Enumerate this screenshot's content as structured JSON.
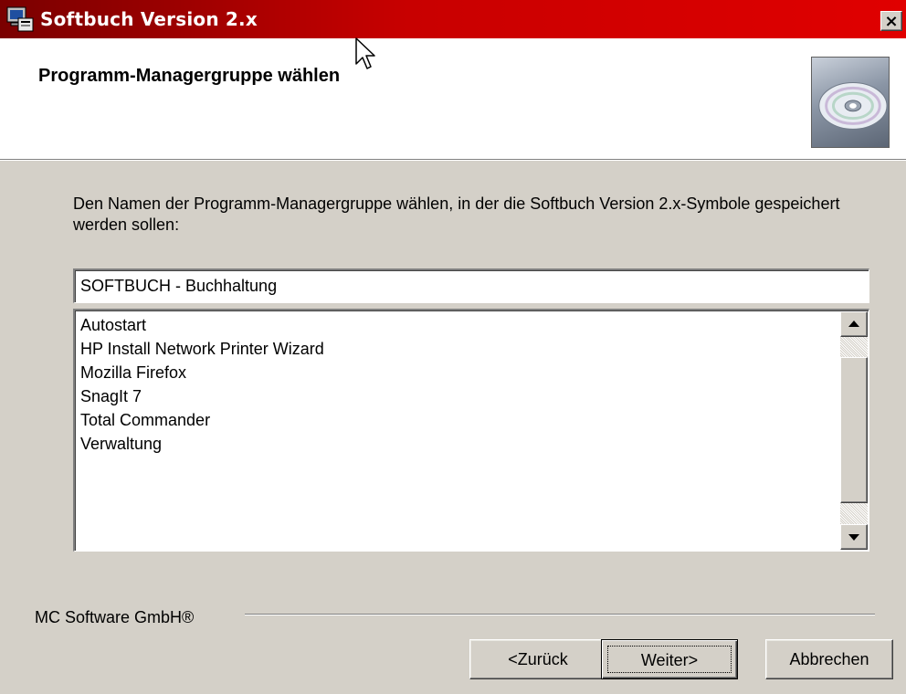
{
  "window": {
    "title": "Softbuch Version 2.x",
    "close_label": "×"
  },
  "header": {
    "title": "Programm-Managergruppe wählen",
    "image_icon": "cd-disc-icon"
  },
  "main": {
    "description": "Den Namen der Programm-Managergruppe wählen, in der die Softbuch Version 2.x-Symbole gespeichert werden sollen:",
    "group_value": "SOFTBUCH - Buchhaltung",
    "list_items": [
      "Autostart",
      "HP Install Network Printer Wizard",
      "Mozilla Firefox",
      "SnagIt 7",
      "Total Commander",
      "Verwaltung"
    ]
  },
  "footer": {
    "brand": "MC Software GmbH®",
    "back_label": "<Zurück",
    "next_label": "Weiter>",
    "cancel_label": "Abbrechen"
  },
  "colors": {
    "titlebar_start": "#7a0000",
    "titlebar_end": "#e00000",
    "dialog_face": "#d4d0c8"
  }
}
